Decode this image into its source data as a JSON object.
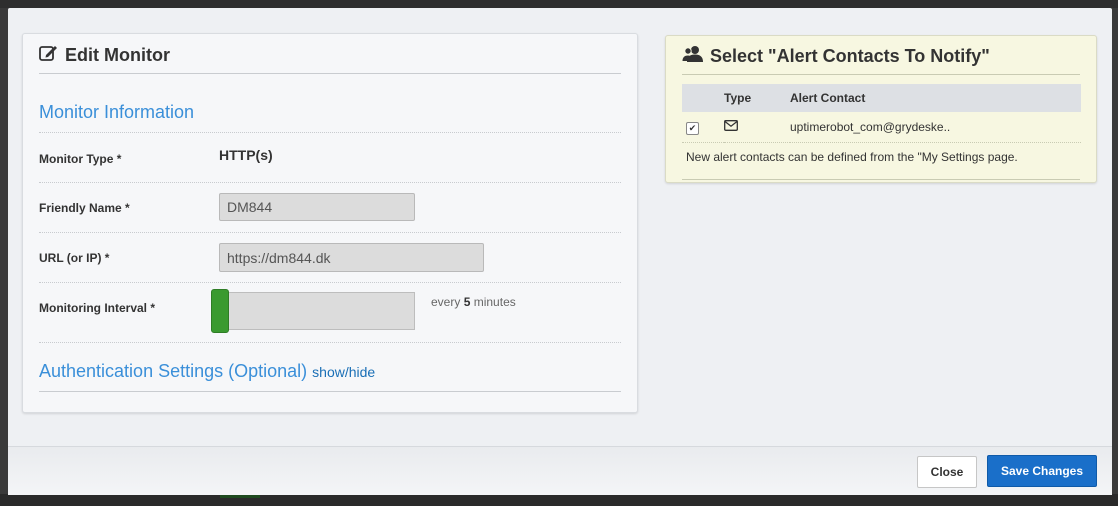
{
  "edit_monitor": {
    "title": "Edit Monitor",
    "monitor_information_heading": "Monitor Information",
    "monitor_type": {
      "label": "Monitor Type *",
      "value": "HTTP(s)"
    },
    "friendly_name": {
      "label": "Friendly Name *",
      "value": "DM844"
    },
    "url": {
      "label": "URL (or IP) *",
      "value": "https://dm844.dk"
    },
    "monitoring_interval": {
      "label": "Monitoring Interval *",
      "prefix": "every",
      "value": "5",
      "unit": "minutes",
      "slider_level": 0
    },
    "authentication": {
      "heading": "Authentication Settings (Optional)",
      "toggle": "show/hide"
    }
  },
  "alert_contacts": {
    "title": "Select \"Alert Contacts To Notify\"",
    "columns": [
      "Type",
      "Alert Contact"
    ],
    "rows": [
      {
        "checked": true,
        "type_icon": "envelope-icon",
        "contact": "uptimerobot_com@grydeske.."
      }
    ],
    "note": "New alert contacts can be defined from the \"My Settings page."
  },
  "footer": {
    "close_label": "Close",
    "save_label": "Save Changes"
  },
  "colors": {
    "accent": "#3a8fd9",
    "primary_button": "#1a6fc9",
    "slider_handle": "#3a9a2f",
    "alert_panel": "#f7f7e1"
  }
}
